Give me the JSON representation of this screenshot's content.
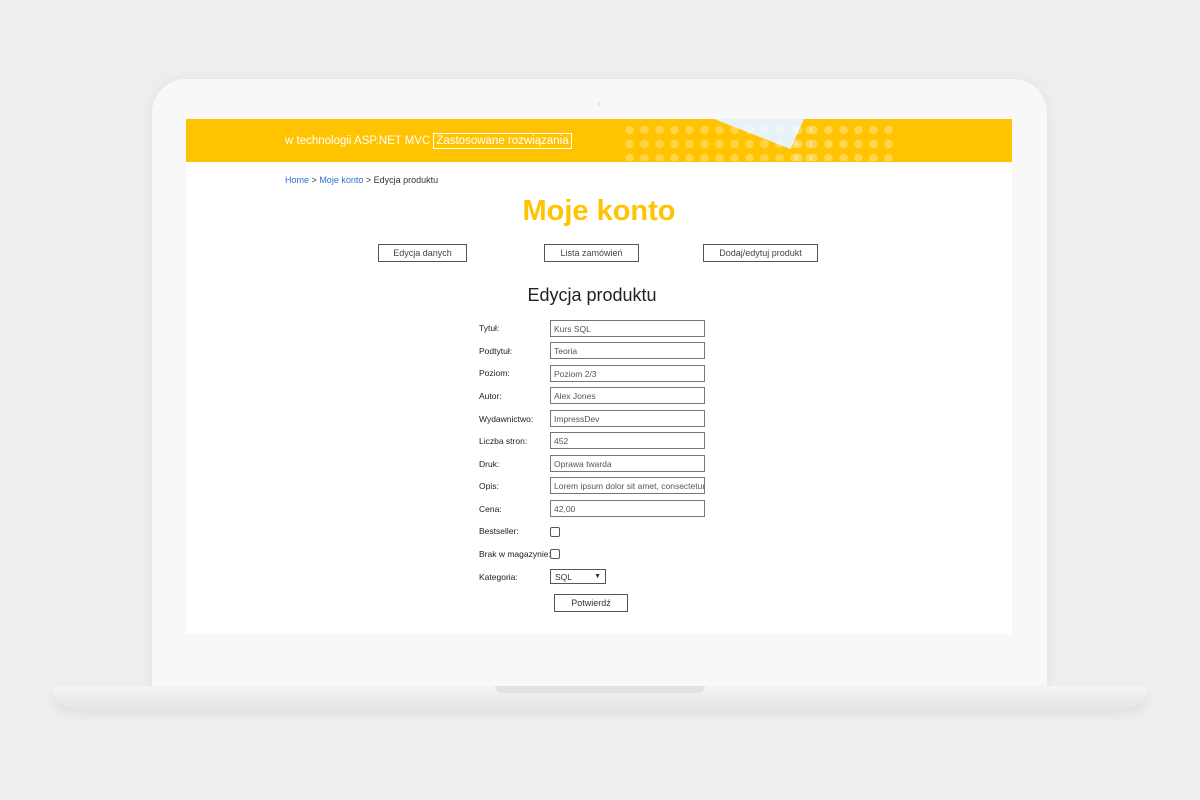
{
  "banner": {
    "text": "w technologii ASP.NET MVC",
    "link_label": "Zastosowane rozwiązania"
  },
  "breadcrumb": {
    "home": "Home",
    "separator": ">",
    "account": "Moje konto",
    "current": "Edycja produktu"
  },
  "page": {
    "title": "Moje konto"
  },
  "tabs": [
    {
      "label": "Edycja danych"
    },
    {
      "label": "Lista zamówień"
    },
    {
      "label": "Dodaj/edytuj produkt"
    }
  ],
  "form": {
    "title": "Edycja produktu",
    "fields": [
      {
        "label": "Tytuł:",
        "value": "Kurs SQL"
      },
      {
        "label": "Podtytuł:",
        "value": "Teoria"
      },
      {
        "label": "Poziom:",
        "value": "Poziom 2/3"
      },
      {
        "label": "Autor:",
        "value": "Alex Jones"
      },
      {
        "label": "Wydawnictwo:",
        "value": "ImpressDev"
      },
      {
        "label": "Liczba stron:",
        "value": "452"
      },
      {
        "label": "Druk:",
        "value": "Oprawa twarda"
      },
      {
        "label": "Opis:",
        "value": "Lorem ipsum dolor sit amet, consectetur"
      },
      {
        "label": "Cena:",
        "value": "42,00"
      }
    ],
    "bestseller": {
      "label": "Bestseller:",
      "checked": false
    },
    "out_of_stock": {
      "label": "Brak w magazynie:",
      "checked": false
    },
    "category": {
      "label": "Kategoria:",
      "selected": "SQL"
    },
    "submit_label": "Potwierdź"
  },
  "colors": {
    "accent": "#ffc300",
    "link": "#2f6fd1"
  }
}
